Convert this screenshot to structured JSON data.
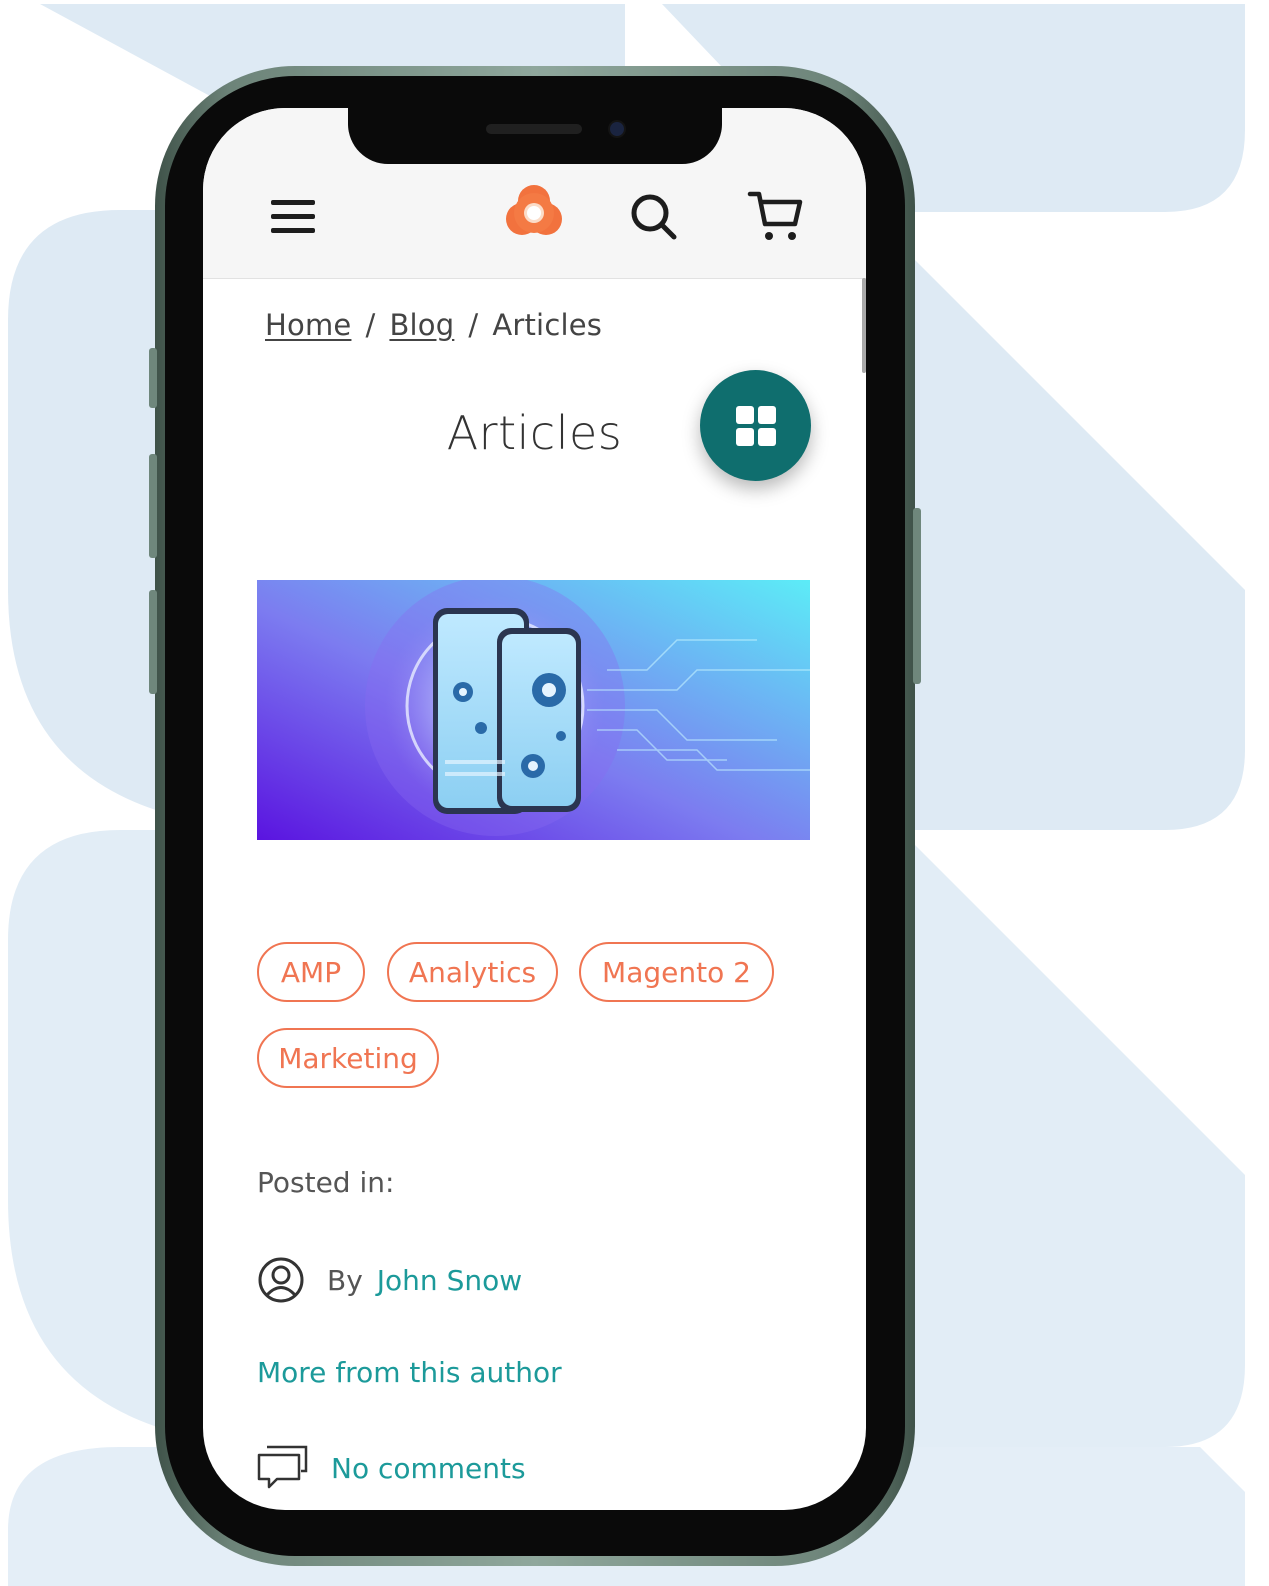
{
  "header": {
    "menu_icon": "hamburger-menu-icon",
    "logo_icon": "flower-logo-icon",
    "search_icon": "search-icon",
    "cart_icon": "shopping-cart-icon"
  },
  "breadcrumb": {
    "items": [
      "Home",
      "Blog",
      "Articles"
    ],
    "separator": "/"
  },
  "page": {
    "title": "Articles",
    "grid_toggle_icon": "grid-view-icon"
  },
  "post": {
    "tags": [
      "AMP",
      "Analytics",
      "Magento 2",
      "Marketing"
    ],
    "posted_in_label": "Posted in:",
    "by_label": "By",
    "author": "John Snow",
    "more_from_author": "More from this author",
    "comments": "No comments"
  },
  "colors": {
    "accent_teal": "#0f6e6e",
    "link_teal": "#1c9a9a",
    "tag_coral": "#f07552",
    "logo_orange": "#f2723e",
    "background_shape": "#deeaf4"
  }
}
